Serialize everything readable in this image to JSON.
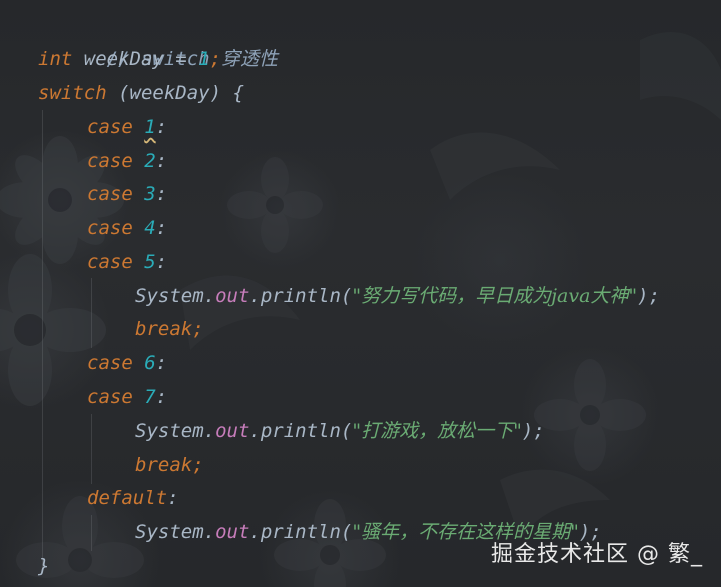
{
  "code": {
    "comment": "// switch 穿透性",
    "decl": {
      "type": "int",
      "name": "weekDay",
      "assign": " = ",
      "value": "1",
      "semi": ";"
    },
    "switch_kw": "switch",
    "switch_expr": " (weekDay) {",
    "case_kw": "case",
    "cases": [
      "1",
      "2",
      "3",
      "4",
      "5",
      "6",
      "7"
    ],
    "colon": ":",
    "default_kw": "default",
    "println": {
      "obj": "System",
      "field": "out",
      "method": ".println(",
      "close": ");"
    },
    "strings": {
      "s1": "\"努力写代码，早日成为java大神\"",
      "s2": "\"打游戏，放松一下\"",
      "s3": "\"骚年，不存在这样的星期\""
    },
    "break_kw": "break",
    "semi": ";",
    "dot": ".",
    "close_brace": "}"
  },
  "watermark": "掘金技术社区 @ 繁_",
  "colors": {
    "background": "#2b2d30",
    "keyword": "#cc7832",
    "number": "#2aacb8",
    "string": "#6aab73",
    "field": "#c77dbb",
    "comment": "#8ea2b8",
    "default_text": "#a9b7c6"
  }
}
